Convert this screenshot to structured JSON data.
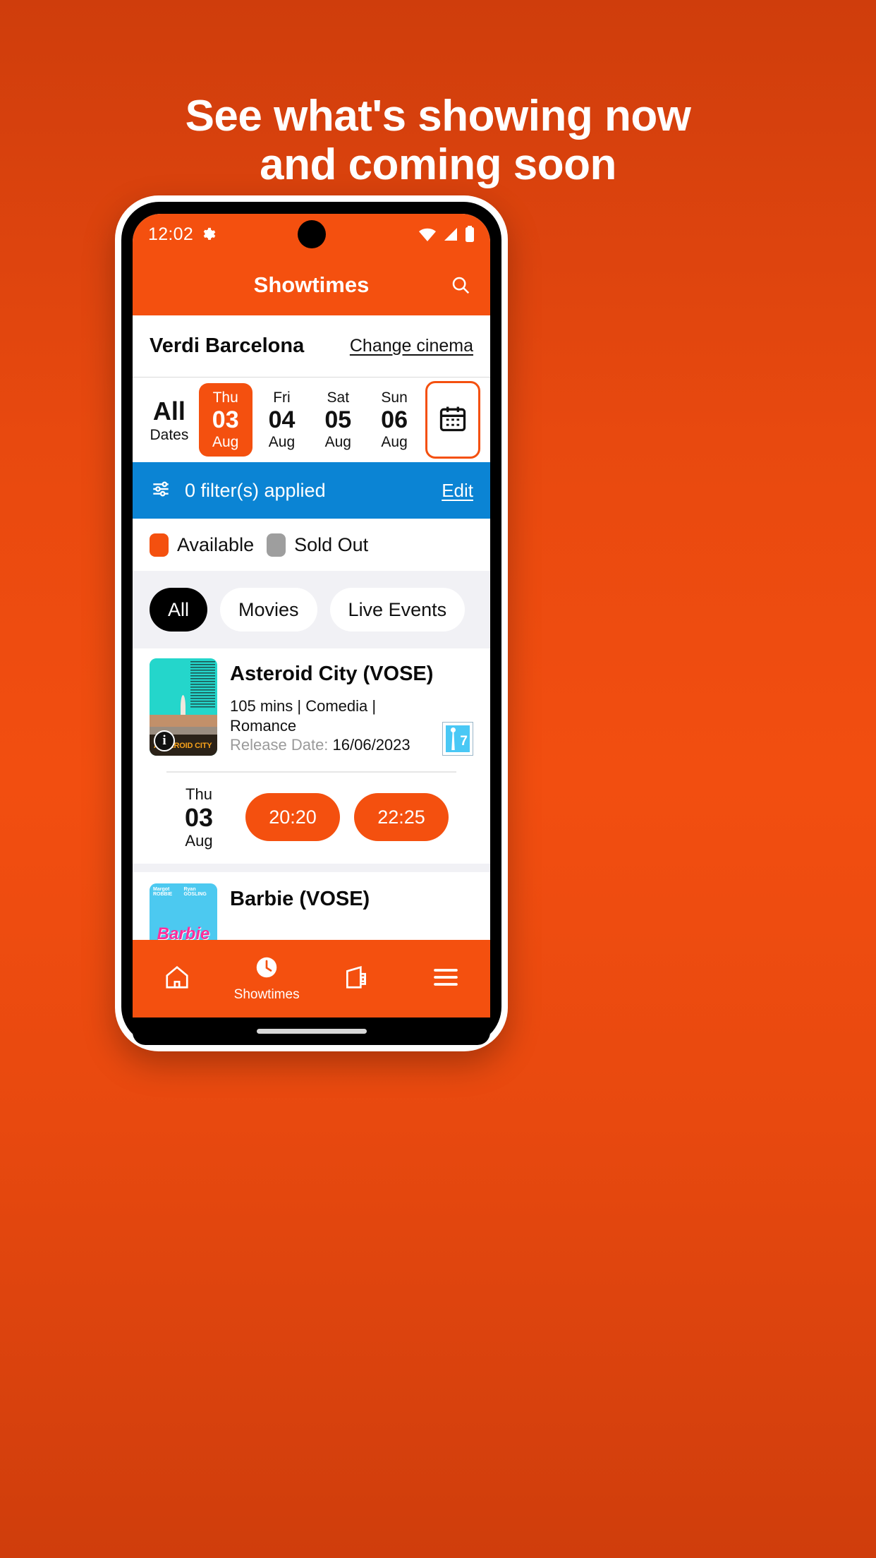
{
  "promo": {
    "headline_line1": "See what's showing now",
    "headline_line2": "and coming soon"
  },
  "status_bar": {
    "time": "12:02",
    "gear_icon": "gear-icon",
    "wifi_icon": "wifi-icon",
    "signal_icon": "cellular-signal-icon",
    "battery_icon": "battery-icon"
  },
  "app_bar": {
    "title": "Showtimes",
    "search_icon": "search-icon"
  },
  "cinema": {
    "name": "Verdi Barcelona",
    "change_label": "Change cinema"
  },
  "dates": {
    "items": [
      {
        "dow": "",
        "num": "All",
        "mon": "Dates",
        "selected": false
      },
      {
        "dow": "Thu",
        "num": "03",
        "mon": "Aug",
        "selected": true
      },
      {
        "dow": "Fri",
        "num": "04",
        "mon": "Aug",
        "selected": false
      },
      {
        "dow": "Sat",
        "num": "05",
        "mon": "Aug",
        "selected": false
      },
      {
        "dow": "Sun",
        "num": "06",
        "mon": "Aug",
        "selected": false
      }
    ],
    "calendar_icon": "calendar-icon"
  },
  "filters": {
    "icon": "filter-sliders-icon",
    "text": "0 filter(s) applied",
    "edit_label": "Edit",
    "bar_color": "#0b84d4"
  },
  "legend": {
    "available_label": "Available",
    "available_color": "#f4500f",
    "soldout_label": "Sold Out",
    "soldout_color": "#9e9e9e"
  },
  "category_tabs": [
    {
      "label": "All",
      "active": true
    },
    {
      "label": "Movies",
      "active": false
    },
    {
      "label": "Live Events",
      "active": false
    }
  ],
  "movies": [
    {
      "title": "Asteroid City (VOSE)",
      "poster_title": "ASTEROID CITY",
      "info_icon": "info-icon",
      "genre": "105 mins | Comedia | Romance",
      "release_prefix": "Release Date: ",
      "release_date": "16/06/2023",
      "rating_badge": "7",
      "showtime_day": {
        "dow": "Thu",
        "num": "03",
        "mon": "Aug"
      },
      "showtimes": [
        "20:20",
        "22:25"
      ]
    },
    {
      "title": "Barbie (VOSE)",
      "poster_title": "Barbie"
    }
  ],
  "bottom_nav": [
    {
      "icon": "home-icon",
      "label": "",
      "active": false
    },
    {
      "icon": "clock-icon",
      "label": "Showtimes",
      "active": true
    },
    {
      "icon": "ticket-wallet-icon",
      "label": "",
      "active": false
    },
    {
      "icon": "hamburger-menu-icon",
      "label": "",
      "active": false
    }
  ],
  "colors": {
    "brand_orange": "#f4500f",
    "background_orange": "#d8400d",
    "filter_blue": "#0b84d4"
  }
}
